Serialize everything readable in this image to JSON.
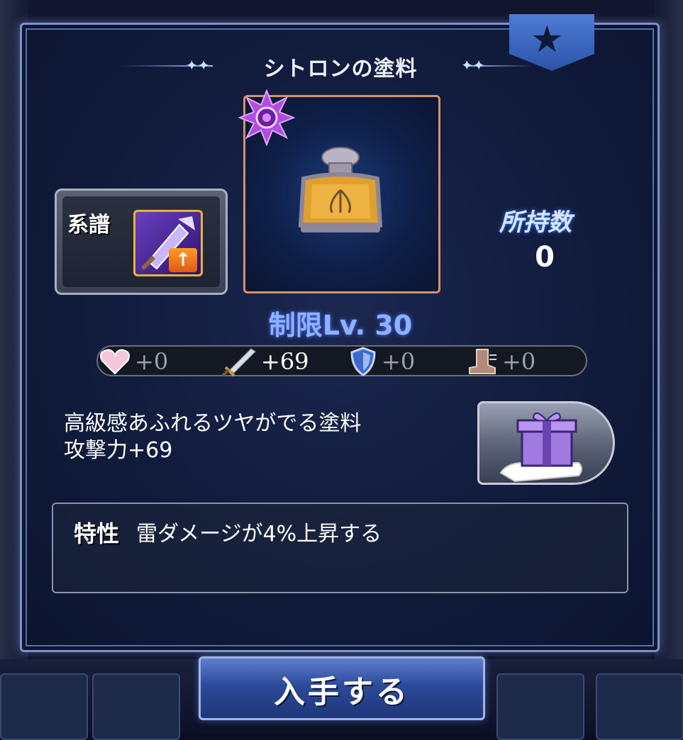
{
  "dialog": {
    "title": "シトロンの塗料",
    "lineage_label": "系譜",
    "held_label": "所持数",
    "held_value": "0",
    "limit": "制限Lv. 30",
    "stats": {
      "hp": "+0",
      "attack": "+69",
      "defense": "+0",
      "speed": "+0"
    },
    "description_line1": "高級感あふれるツヤがでる塗料",
    "description_line2": "攻撃力+69",
    "trait_label": "特性",
    "trait_text": "雷ダメージが4%上昇する",
    "obtain_button": "入手する"
  },
  "icons": {
    "rarity": "purple-sun-badge-icon",
    "item": "paint-bottle-icon",
    "lineage": "weapon-upgrade-icon",
    "hp": "heart-icon",
    "attack": "sword-icon",
    "defense": "shield-icon",
    "speed": "boot-icon",
    "gift": "gift-icon",
    "ribbon": "star-icon"
  },
  "colors": {
    "accent": "#8fb0ff",
    "frame": "#d3936b",
    "rarity": "#b04de0"
  }
}
